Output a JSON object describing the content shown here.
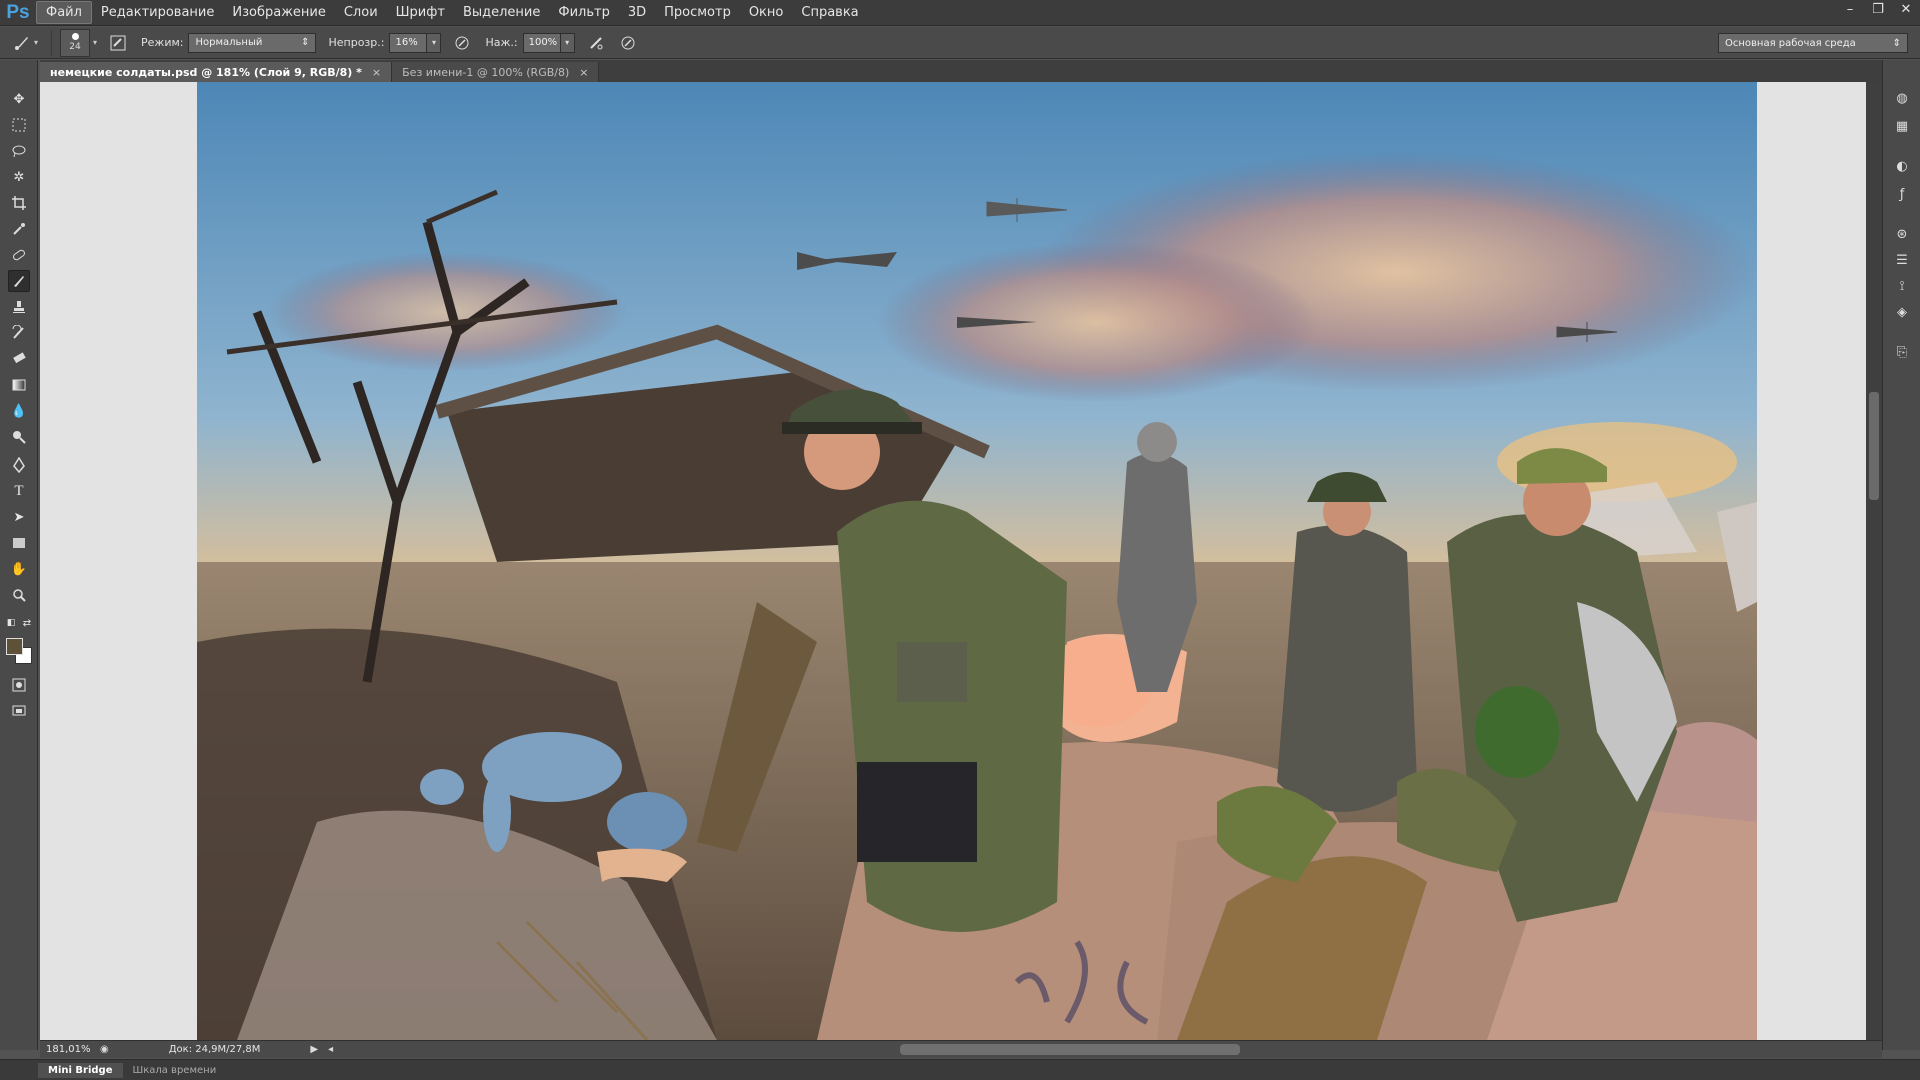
{
  "app": {
    "logo": "Ps"
  },
  "menu": {
    "items": [
      "Файл",
      "Редактирование",
      "Изображение",
      "Слои",
      "Шрифт",
      "Выделение",
      "Фильтр",
      "3D",
      "Просмотр",
      "Окно",
      "Справка"
    ]
  },
  "window_controls": {
    "minimize": "–",
    "restore": "❐",
    "close": "✕"
  },
  "options_bar": {
    "brush_size": "24",
    "mode_label": "Режим:",
    "mode_value": "Нормальный",
    "opacity_label": "Непрозр.:",
    "opacity_value": "16%",
    "pressure_label": "Наж.:",
    "pressure_value": "100%",
    "workspace": "Основная рабочая среда"
  },
  "tabs": [
    {
      "label": "немецкие солдаты.psd @ 181% (Слой 9, RGB/8) *",
      "close": "×",
      "active": true
    },
    {
      "label": "Без имени-1 @ 100% (RGB/8)",
      "close": "×",
      "active": false
    }
  ],
  "status": {
    "zoom": "181,01%",
    "doc": "Док: 24,9M/27,8M"
  },
  "bottom_tabs": [
    "Mini Bridge",
    "Шкала времени"
  ],
  "colors": {
    "foreground": "#5d5238",
    "background": "#ffffff",
    "accent": "#4aa3df"
  }
}
